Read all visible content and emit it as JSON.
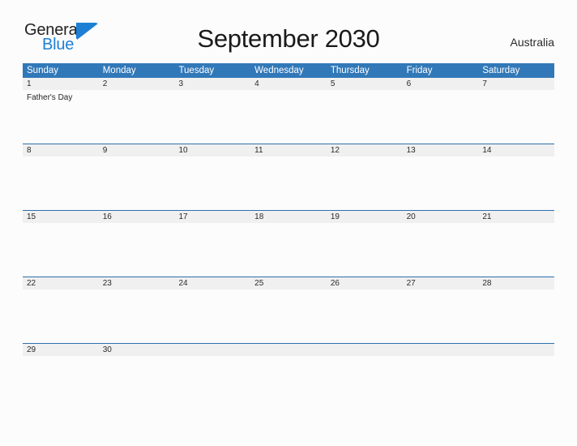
{
  "brand": {
    "name_part1": "General",
    "name_part2": "Blue",
    "flag_icon": "blue-triangle-flag-icon",
    "primary_color": "#1C7FD4"
  },
  "header": {
    "title": "September 2030",
    "region": "Australia"
  },
  "colors": {
    "header_blue": "#3178B8",
    "row_divider_blue": "#2E6FAD",
    "date_band_gray": "#F0F0F0",
    "page_background": "#FCFCFD",
    "text_dark": "#262626"
  },
  "calendar": {
    "month": "September",
    "year": "2030",
    "weekday_headers": [
      "Sunday",
      "Monday",
      "Tuesday",
      "Wednesday",
      "Thursday",
      "Friday",
      "Saturday"
    ],
    "weeks": [
      {
        "days": [
          {
            "date": "1",
            "events": [
              "Father's Day"
            ]
          },
          {
            "date": "2",
            "events": []
          },
          {
            "date": "3",
            "events": []
          },
          {
            "date": "4",
            "events": []
          },
          {
            "date": "5",
            "events": []
          },
          {
            "date": "6",
            "events": []
          },
          {
            "date": "7",
            "events": []
          }
        ]
      },
      {
        "days": [
          {
            "date": "8",
            "events": []
          },
          {
            "date": "9",
            "events": []
          },
          {
            "date": "10",
            "events": []
          },
          {
            "date": "11",
            "events": []
          },
          {
            "date": "12",
            "events": []
          },
          {
            "date": "13",
            "events": []
          },
          {
            "date": "14",
            "events": []
          }
        ]
      },
      {
        "days": [
          {
            "date": "15",
            "events": []
          },
          {
            "date": "16",
            "events": []
          },
          {
            "date": "17",
            "events": []
          },
          {
            "date": "18",
            "events": []
          },
          {
            "date": "19",
            "events": []
          },
          {
            "date": "20",
            "events": []
          },
          {
            "date": "21",
            "events": []
          }
        ]
      },
      {
        "days": [
          {
            "date": "22",
            "events": []
          },
          {
            "date": "23",
            "events": []
          },
          {
            "date": "24",
            "events": []
          },
          {
            "date": "25",
            "events": []
          },
          {
            "date": "26",
            "events": []
          },
          {
            "date": "27",
            "events": []
          },
          {
            "date": "28",
            "events": []
          }
        ]
      },
      {
        "days": [
          {
            "date": "29",
            "events": []
          },
          {
            "date": "30",
            "events": []
          },
          {
            "date": "",
            "events": []
          },
          {
            "date": "",
            "events": []
          },
          {
            "date": "",
            "events": []
          },
          {
            "date": "",
            "events": []
          },
          {
            "date": "",
            "events": []
          }
        ]
      }
    ]
  }
}
